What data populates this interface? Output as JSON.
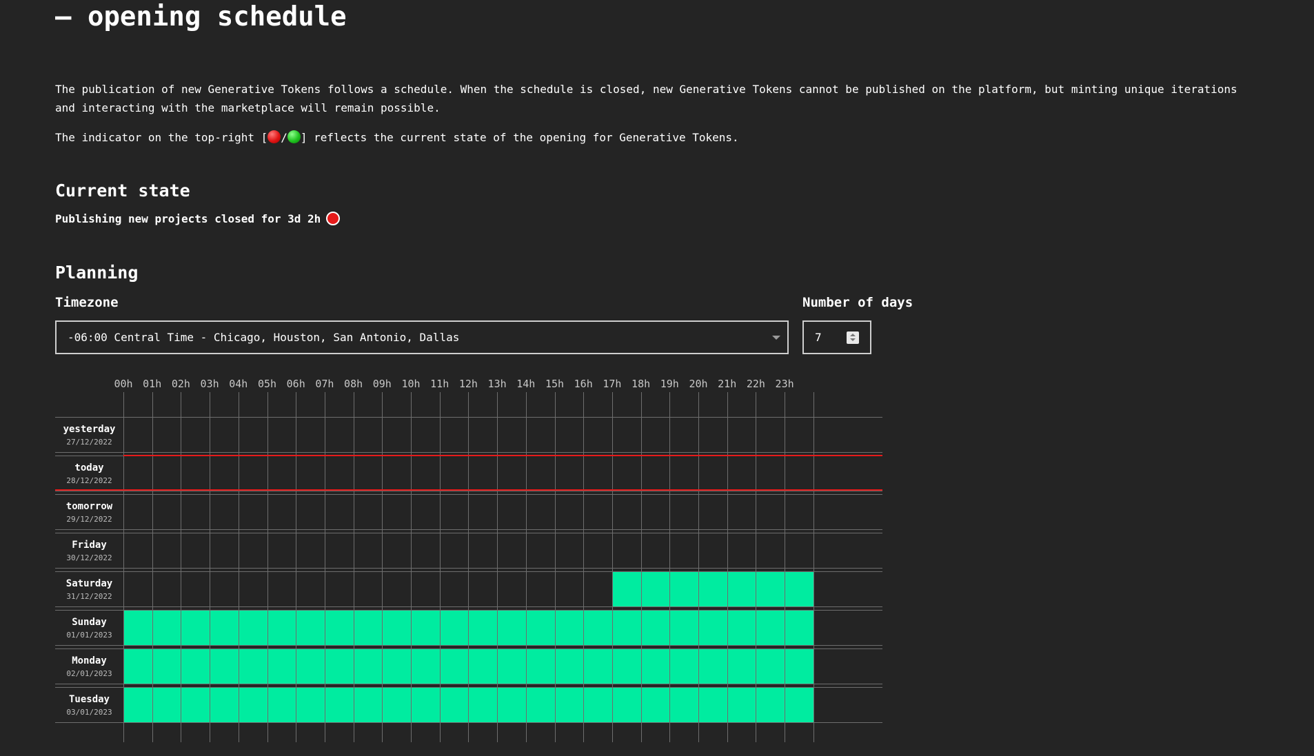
{
  "page": {
    "title": "— opening schedule",
    "intro_p1": "The publication of new Generative Tokens follows a schedule. When the schedule is closed, new Generative Tokens cannot be published on the platform, but minting unique iterations and interacting with the marketplace will remain possible.",
    "indicator_prefix": "The indicator on the top-right [",
    "indicator_sep": "/",
    "indicator_suffix": "] reflects the current state of the opening for Generative Tokens."
  },
  "current_state": {
    "heading": "Current state",
    "status_text": "Publishing new projects closed for 3d 2h",
    "status": "closed",
    "status_color": "#e61b1b"
  },
  "planning": {
    "heading": "Planning",
    "timezone_label": "Timezone",
    "timezone_value": "-06:00 Central Time - Chicago, Houston, San Antonio, Dallas",
    "days_label": "Number of days",
    "days_value": "7"
  },
  "schedule": {
    "hours": [
      "00h",
      "01h",
      "02h",
      "03h",
      "04h",
      "05h",
      "06h",
      "07h",
      "08h",
      "09h",
      "10h",
      "11h",
      "12h",
      "13h",
      "14h",
      "15h",
      "16h",
      "17h",
      "18h",
      "19h",
      "20h",
      "21h",
      "22h",
      "23h"
    ],
    "open_color": "#00eca0",
    "now_color": "#e61b1b",
    "days": [
      {
        "name": "yesterday",
        "date": "27/12/2022",
        "open_from": null
      },
      {
        "name": "today",
        "date": "28/12/2022",
        "open_from": null
      },
      {
        "name": "tomorrow",
        "date": "29/12/2022",
        "open_from": null
      },
      {
        "name": "Friday",
        "date": "30/12/2022",
        "open_from": null
      },
      {
        "name": "Saturday",
        "date": "31/12/2022",
        "open_from": 17
      },
      {
        "name": "Sunday",
        "date": "01/01/2023",
        "open_from": 0
      },
      {
        "name": "Monday",
        "date": "02/01/2023",
        "open_from": 0
      },
      {
        "name": "Tuesday",
        "date": "03/01/2023",
        "open_from": 0
      }
    ]
  }
}
